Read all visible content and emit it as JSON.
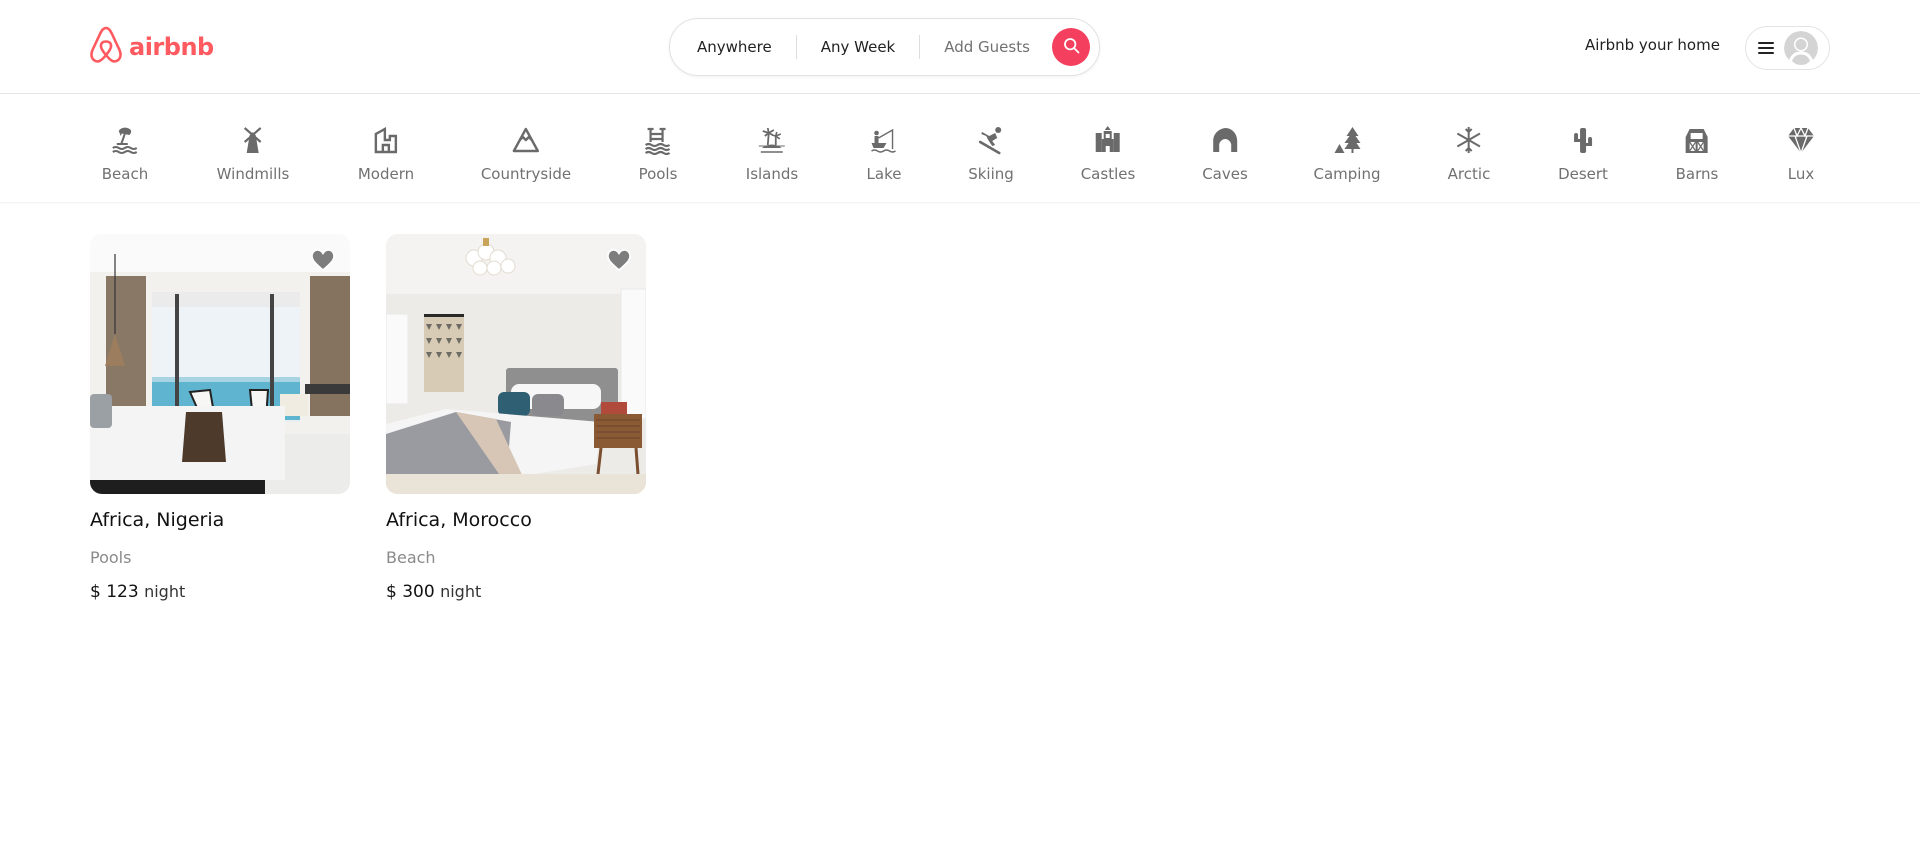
{
  "brand": {
    "name": "airbnb",
    "color": "#ff5a5f",
    "logo_icon": "airbnb-belo-icon"
  },
  "search": {
    "location": "Anywhere",
    "week": "Any Week",
    "guests_placeholder": "Add Guests",
    "button_icon": "search-icon",
    "button_color": "#f43f5e"
  },
  "header": {
    "host_link": "Airbnb your home",
    "menu_icon": "hamburger-icon",
    "avatar_icon": "user-avatar-icon"
  },
  "categories": [
    {
      "label": "Beach",
      "icon": "beach-umbrella-icon"
    },
    {
      "label": "Windmills",
      "icon": "windmill-icon"
    },
    {
      "label": "Modern",
      "icon": "modern-building-icon"
    },
    {
      "label": "Countryside",
      "icon": "mountain-icon"
    },
    {
      "label": "Pools",
      "icon": "pool-ladder-icon"
    },
    {
      "label": "Islands",
      "icon": "palm-island-icon"
    },
    {
      "label": "Lake",
      "icon": "fishing-boat-icon"
    },
    {
      "label": "Skiing",
      "icon": "skier-icon"
    },
    {
      "label": "Castles",
      "icon": "castle-icon"
    },
    {
      "label": "Caves",
      "icon": "cave-icon"
    },
    {
      "label": "Camping",
      "icon": "tent-tree-icon"
    },
    {
      "label": "Arctic",
      "icon": "snowflake-icon"
    },
    {
      "label": "Desert",
      "icon": "cactus-icon"
    },
    {
      "label": "Barns",
      "icon": "barn-icon"
    },
    {
      "label": "Lux",
      "icon": "diamond-icon"
    }
  ],
  "listings": [
    {
      "title": "Africa, Nigeria",
      "category": "Pools",
      "currency": "$",
      "price": "123",
      "unit": "night",
      "image": "bedroom-with-sea-view-photo"
    },
    {
      "title": "Africa, Morocco",
      "category": "Beach",
      "currency": "$",
      "price": "300",
      "unit": "night",
      "image": "bedroom-with-grey-headboard-photo"
    }
  ]
}
